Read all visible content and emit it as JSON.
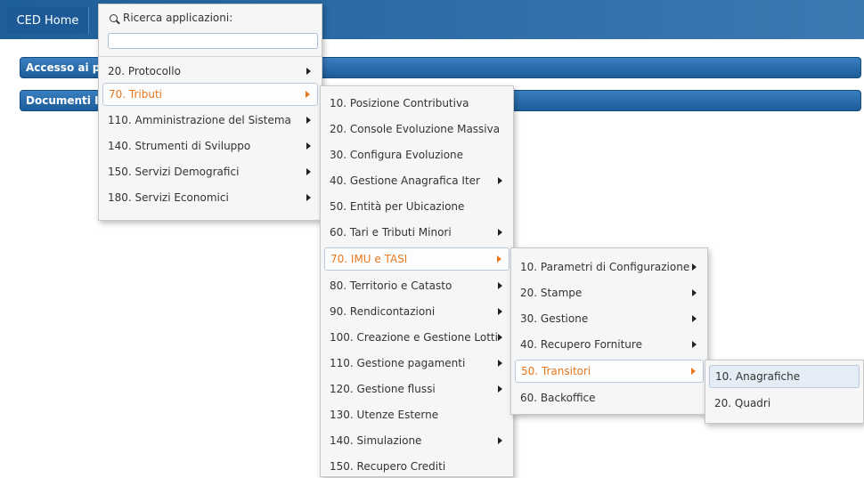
{
  "header": {
    "home_tab": "CED Home"
  },
  "panels": {
    "panel1_title": "Accesso ai pr",
    "panel2_title": "Documenti Ir"
  },
  "search": {
    "label": "Ricerca applicazioni:",
    "value": "",
    "icon": "search-icon"
  },
  "menu1": {
    "items": [
      {
        "label": "20. Protocollo"
      },
      {
        "label": "70. Tributi"
      },
      {
        "label": "110. Amministrazione del Sistema"
      },
      {
        "label": "140. Strumenti di Sviluppo"
      },
      {
        "label": "150. Servizi Demografici"
      },
      {
        "label": "180. Servizi Economici"
      }
    ]
  },
  "menu2": {
    "items": [
      {
        "label": "10. Posizione Contributiva"
      },
      {
        "label": "20. Console Evoluzione Massiva"
      },
      {
        "label": "30. Configura Evoluzione"
      },
      {
        "label": "40. Gestione Anagrafica Iter"
      },
      {
        "label": "50. Entità per Ubicazione"
      },
      {
        "label": "60. Tari e Tributi Minori"
      },
      {
        "label": "70. IMU e TASI"
      },
      {
        "label": "80. Territorio e Catasto"
      },
      {
        "label": "90. Rendicontazioni"
      },
      {
        "label": "100. Creazione e Gestione Lotti"
      },
      {
        "label": "110. Gestione pagamenti"
      },
      {
        "label": "120. Gestione flussi"
      },
      {
        "label": "130. Utenze Esterne"
      },
      {
        "label": "140. Simulazione"
      },
      {
        "label": "150. Recupero Crediti"
      }
    ]
  },
  "menu3": {
    "items": [
      {
        "label": "10. Parametri di Configurazione"
      },
      {
        "label": "20. Stampe"
      },
      {
        "label": "30. Gestione"
      },
      {
        "label": "40. Recupero Forniture"
      },
      {
        "label": "50. Transitori"
      },
      {
        "label": "60. Backoffice"
      }
    ]
  },
  "menu4": {
    "items": [
      {
        "label": "10. Anagrafiche"
      },
      {
        "label": "20. Quadri"
      }
    ]
  },
  "colors": {
    "topbar": "#2a6aa6",
    "active_text": "#e8781e",
    "panel_bar": "#1c5d99"
  }
}
